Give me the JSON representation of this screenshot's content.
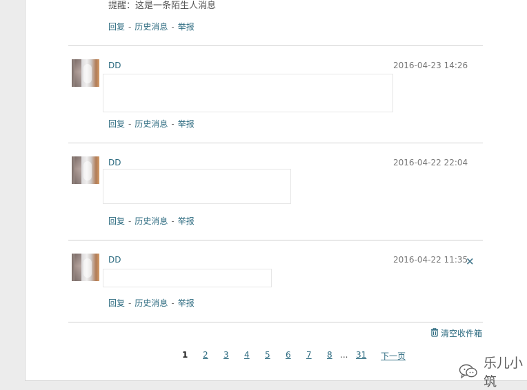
{
  "top_message": {
    "text": "提醒：这是一条陌生人消息",
    "actions": {
      "reply": "回复",
      "history": "历史消息",
      "report": "举报"
    }
  },
  "messages": [
    {
      "sender": "DD",
      "time": "2016-04-23 14:26",
      "actions": {
        "reply": "回复",
        "history": "历史消息",
        "report": "举报"
      }
    },
    {
      "sender": "DD",
      "time": "2016-04-22 22:04",
      "actions": {
        "reply": "回复",
        "history": "历史消息",
        "report": "举报"
      }
    },
    {
      "sender": "DD",
      "time": "2016-04-22 11:35",
      "actions": {
        "reply": "回复",
        "history": "历史消息",
        "report": "举报"
      }
    }
  ],
  "separator": "-",
  "icons": {
    "close": "close-icon",
    "clear": "trash-icon",
    "watermark": "chat-bubble-icon"
  },
  "clear_inbox": "清空收件箱",
  "pagination": {
    "current": "1",
    "pages": [
      "2",
      "3",
      "4",
      "5",
      "6",
      "7",
      "8"
    ],
    "ellipsis": "...",
    "last": "31",
    "next": "下一页"
  },
  "watermark": "乐儿小筑",
  "colors": {
    "link": "#2d6b80",
    "muted": "#777777",
    "divider": "#cfcfcf",
    "background": "#ececec"
  }
}
